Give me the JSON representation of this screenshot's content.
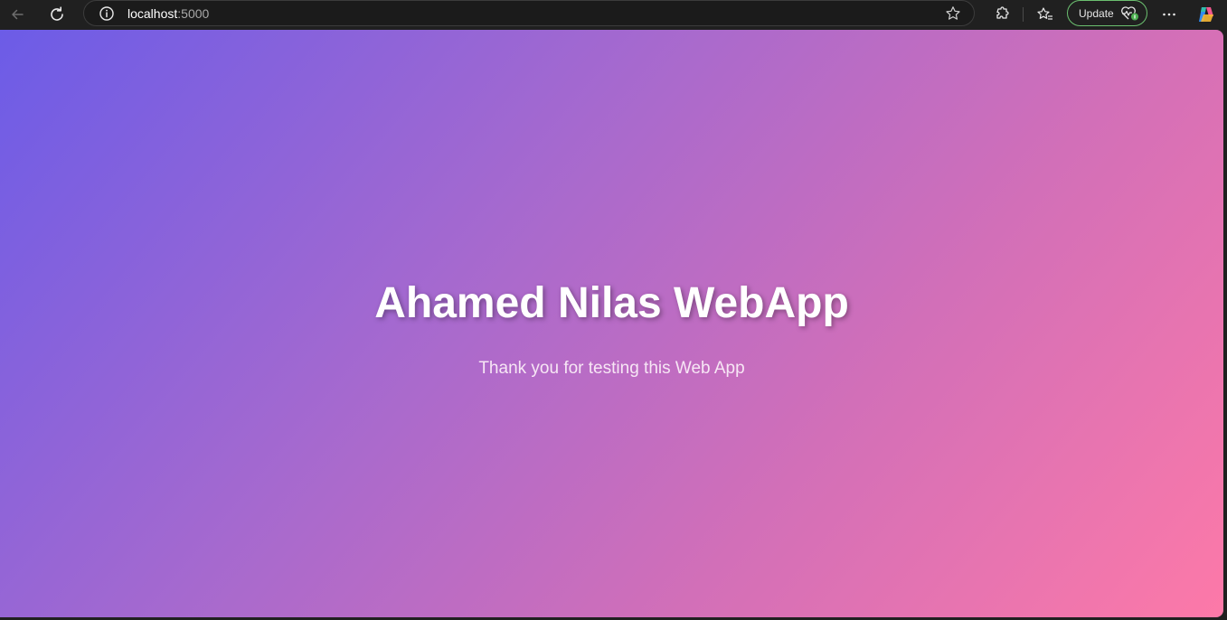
{
  "browser": {
    "address": {
      "host": "localhost",
      "port": ":5000"
    },
    "update_button": {
      "label": "Update"
    },
    "colors": {
      "toolbar_bg": "#202020",
      "update_border": "#6bbf6f"
    },
    "icons": [
      "back-arrow-icon",
      "reload-icon",
      "site-info-icon",
      "favorite-star-icon",
      "extensions-icon",
      "favorites-icon",
      "health-icon",
      "more-options-icon",
      "copilot-icon"
    ]
  },
  "page": {
    "title": "Ahamed Nilas WebApp",
    "subtitle": "Thank you for testing this Web App",
    "colors": {
      "gradient_start": "#6c5ce7",
      "gradient_end": "#fd79a8",
      "title_text": "#ffffff"
    }
  }
}
